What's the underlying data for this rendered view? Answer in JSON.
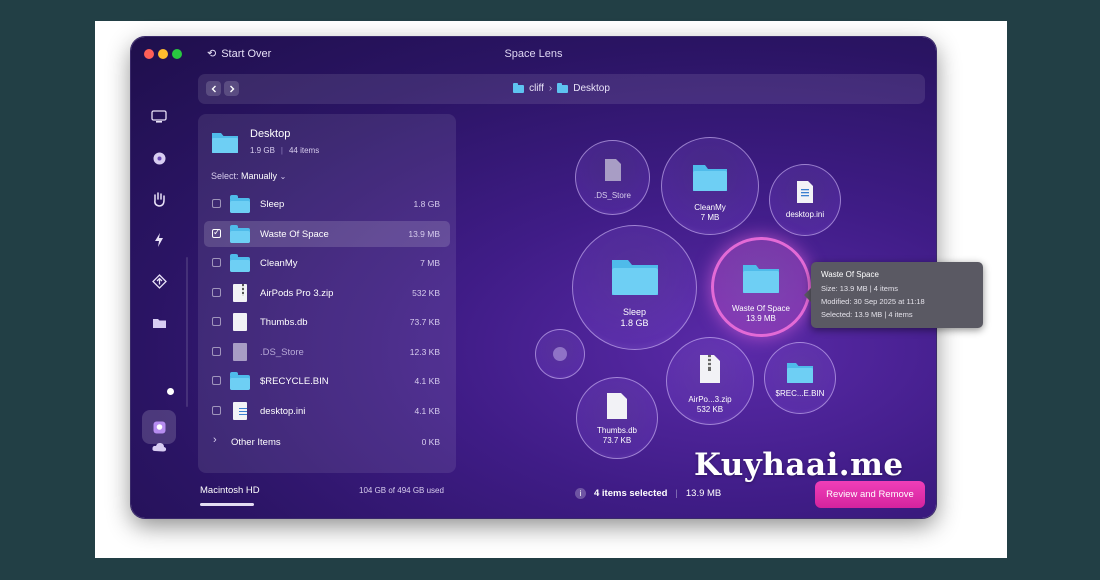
{
  "window": {
    "title": "Space Lens",
    "start_over_label": "Start Over"
  },
  "pathbar": {
    "crumb_1": "cliff",
    "separator": "›",
    "crumb_2": "Desktop"
  },
  "sidebar": {
    "icons": [
      "monitor-icon",
      "disk-icon",
      "hand-icon",
      "lightning-icon",
      "updater-icon",
      "folder-icon",
      "space-lens-icon",
      "cloud-icon"
    ],
    "bottom_icon": "assistant-icon"
  },
  "panel": {
    "folder_name": "Desktop",
    "folder_size": "1.9 GB",
    "folder_count": "44 items",
    "select_label": "Select:",
    "select_value": "Manually",
    "rows": [
      {
        "name": "Sleep",
        "size": "1.8 GB",
        "checked": false,
        "icon": "folder-icon"
      },
      {
        "name": "Waste Of Space",
        "size": "13.9 MB",
        "checked": true,
        "icon": "folder-icon"
      },
      {
        "name": "CleanMy",
        "size": "7 MB",
        "checked": false,
        "icon": "folder-icon"
      },
      {
        "name": "AirPods Pro 3.zip",
        "size": "532 KB",
        "checked": false,
        "icon": "zip-file-icon"
      },
      {
        "name": "Thumbs.db",
        "size": "73.7 KB",
        "checked": false,
        "icon": "document-icon"
      },
      {
        "name": ".DS_Store",
        "size": "12.3 KB",
        "checked": false,
        "icon": "document-icon"
      },
      {
        "name": "$RECYCLE.BIN",
        "size": "4.1 KB",
        "checked": false,
        "icon": "folder-icon"
      },
      {
        "name": "desktop.ini",
        "size": "4.1 KB",
        "checked": false,
        "icon": "ini-file-icon"
      }
    ],
    "other_items": {
      "name": "Other Items",
      "size": "0 KB"
    }
  },
  "disk": {
    "name": "Macintosh HD",
    "usage": "104 GB of 494 GB used",
    "used_fraction": 0.21
  },
  "bubbles": {
    "ds_store": {
      "name": ".DS_Store"
    },
    "cleanmy": {
      "name": "CleanMy",
      "size": "7 MB"
    },
    "desktop_ini": {
      "name": "desktop.ini"
    },
    "sleep": {
      "name": "Sleep",
      "size": "1.8 GB"
    },
    "waste": {
      "name": "Waste Of Space",
      "size": "13.9 MB"
    },
    "thumbs": {
      "name": "Thumbs.db",
      "size": "73.7 KB"
    },
    "airpods": {
      "name": "AirPo...3.zip",
      "size": "532 KB"
    },
    "recycle": {
      "name": "$REC...E.BIN"
    }
  },
  "tooltip": {
    "title": "Waste Of Space",
    "size_line": "Size: 13.9 MB  |  4 items",
    "modified_line": "Modified: 30 Sep 2025 at 11:18",
    "selected_line": "Selected: 13.9 MB  |  4 items"
  },
  "footer": {
    "selected_count": "4 items selected",
    "selected_size": "13.9 MB",
    "review_button": "Review and Remove"
  },
  "watermark": "Kuyhaai.me",
  "colors": {
    "accent": "#e036b4",
    "highlight_ring": "#e36ad6",
    "folder": "#4fbbea"
  }
}
